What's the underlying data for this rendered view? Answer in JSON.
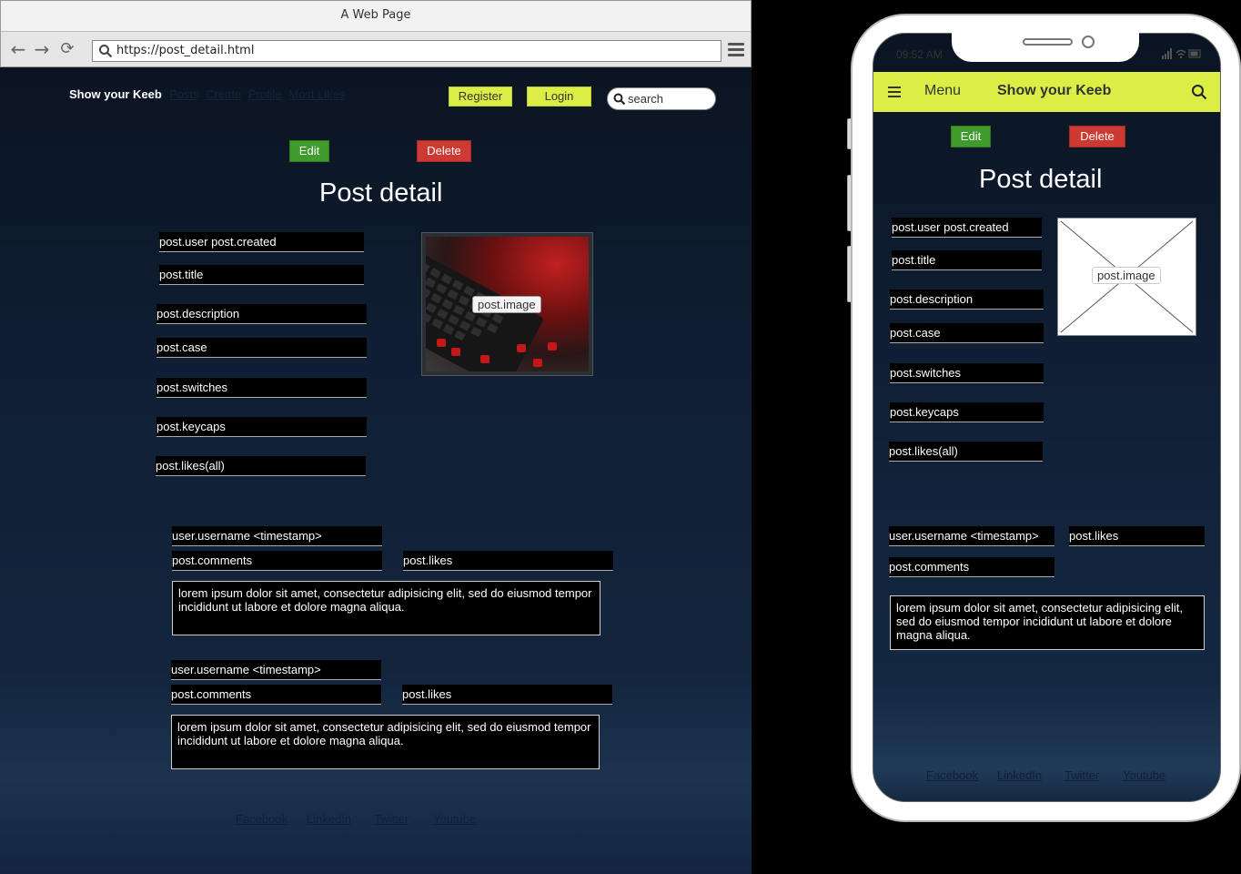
{
  "browser": {
    "window_title": "A Web Page",
    "url": "https://post_detail.html",
    "brand": "Show your Keeb",
    "nav_links": [
      "Posts",
      "Create",
      "Profile",
      "Most Likes"
    ],
    "register_label": "Register",
    "login_label": "Login",
    "search_placeholder": "search",
    "edit_label": "Edit",
    "delete_label": "Delete",
    "page_title": "Post detail",
    "fields": {
      "user_created": "post.user post.created",
      "title": "post.title",
      "description": "post.description",
      "case": "post.case",
      "switches": "post.switches",
      "keycaps": "post.keycaps",
      "likes_all": "post.likes(all)"
    },
    "image_label": "post.image",
    "comments": [
      {
        "username": "user.username <timestamp>",
        "comments": "post.comments",
        "likes": "post.likes",
        "body": "lorem ipsum dolor sit amet, consectetur adipisicing elit, sed do eiusmod tempor incididunt ut labore et dolore magna aliqua."
      },
      {
        "username": "user.username <timestamp>",
        "comments": "post.comments",
        "likes": "post.likes",
        "body": "lorem ipsum dolor sit amet, consectetur adipisicing elit, sed do eiusmod tempor incididunt ut labore et dolore magna aliqua."
      }
    ],
    "footer_links": [
      "Facebook",
      "LinkedIn",
      "Twitter",
      "Youtube"
    ]
  },
  "phone": {
    "status_time": "09:52 AM",
    "menu_label": "Menu",
    "brand": "Show your Keeb",
    "edit_label": "Edit",
    "delete_label": "Delete",
    "page_title": "Post detail",
    "fields": {
      "user_created": "post.user post.created",
      "title": "post.title",
      "description": "post.description",
      "case": "post.case",
      "switches": "post.switches",
      "keycaps": "post.keycaps",
      "likes_all": "post.likes(all)"
    },
    "image_label": "post.image",
    "comment": {
      "username": "user.username <timestamp>",
      "likes": "post.likes",
      "comments": "post.comments",
      "body": "lorem ipsum dolor sit amet, consectetur adipisicing elit, sed do eiusmod tempor incididunt ut labore et dolore magna aliqua."
    },
    "footer_links": [
      "Facebook",
      "LinkedIn",
      "Twitter",
      "Youtube"
    ]
  },
  "colors": {
    "accent_yellow": "#dbee45",
    "edit_green": "#3f9b2b",
    "delete_red": "#cc3a32",
    "background_navy": "#0f1e33"
  },
  "icons": {
    "back": "arrow-left-icon",
    "forward": "arrow-right-icon",
    "reload": "reload-icon",
    "search": "search-icon",
    "menu": "hamburger-icon"
  }
}
